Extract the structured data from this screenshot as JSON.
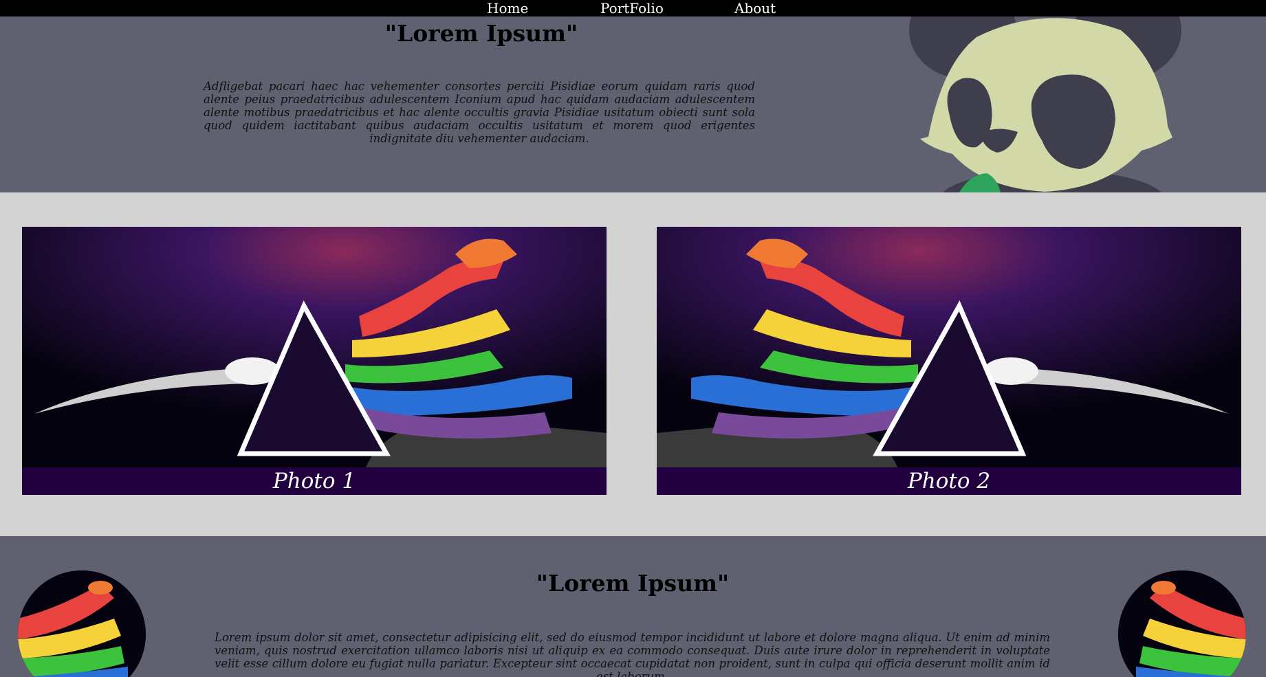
{
  "nav": {
    "items": [
      "Home",
      "PortFolio",
      "About"
    ]
  },
  "hero": {
    "title": "\"Lorem Ipsum\"",
    "text": "Adfligebat pacari haec hac vehementer consortes perciti Pisidiae eorum quidam raris quod alente peius praedatricibus adulescentem Iconium apud hac quidam audaciam adulescentem alente motibus praedatricibus et hac alente occultis gravia Pisidiae usitatum obiecti sunt sola quod quidem iactitabant quibus audaciam occultis usitatum et morem quod erigentes indignitate diu vehementer audaciam."
  },
  "gallery": [
    {
      "caption": "Photo 1"
    },
    {
      "caption": "Photo 2"
    }
  ],
  "lower": {
    "title": "\"Lorem Ipsum\"",
    "text": "Lorem ipsum dolor sit amet, consectetur adipisicing elit, sed do eiusmod tempor incididunt ut labore et dolore magna aliqua. Ut enim ad minim veniam, quis nostrud exercitation ullamco laboris nisi ut aliquip ex ea commodo consequat. Duis aute irure dolor in reprehenderit in voluptate velit esse cillum dolore eu fugiat nulla pariatur. Excepteur sint occaecat cupidatat non proident, sunt in culpa qui officia deserunt mollit anim id est laborum."
  },
  "colors": {
    "nav_bg": "#000000",
    "section_bg": "#5f6170",
    "page_bg": "#d3d3d3",
    "caption_bg": "#22003f"
  }
}
